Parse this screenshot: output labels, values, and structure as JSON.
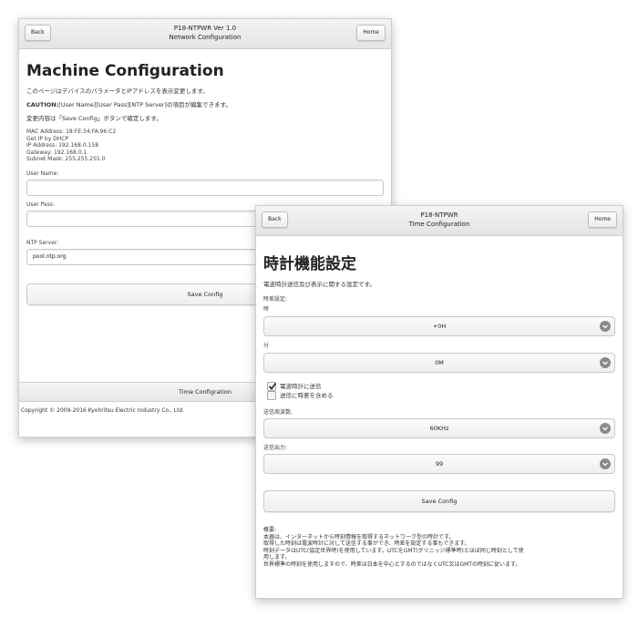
{
  "win1": {
    "back_label": "Back",
    "home_label": "Home",
    "header_title": "P18-NTPWR Ver 1.0",
    "header_subtitle": "Network Configuration",
    "page_title": "Machine Configuration",
    "intro": "このページはデバイスのパラメータとIPアドレスを表示変更します。",
    "caution_prefix": "CAUTION:",
    "caution_text": "[User Name][User Pass][NTP Server]の項目が編集できます。",
    "confirm_text": "変更内容は「Save Config」ボタンで確定します。",
    "mac": "MAC Address: 18:FE:34:FA:96:C2",
    "dhcp": "Get IP by DHCP",
    "ip": "IP Address: 192.168.0.158",
    "gateway": "Gateway: 192.168.0.1",
    "subnet": "Subnet Mask: 255.255.255.0",
    "user_name_label": "User Name:",
    "user_name_value": "",
    "user_pass_label": "User Pass:",
    "user_pass_value": "",
    "ntp_label": "NTP Server:",
    "ntp_value": "pool.ntp.org",
    "save_label": "Save Config",
    "time_nav": "Time Configration",
    "copyright": "Copyright © 2009-2016 Kyohritsu Electric Industry Co., Ltd."
  },
  "win2": {
    "back_label": "Back",
    "home_label": "Home",
    "header_title": "P18-NTPWR",
    "header_subtitle": "Time Configuration",
    "page_title": "時計機能設定",
    "intro": "電波時計送信及び表示に関する設定です。",
    "offset_label": "時差設定:",
    "hour_label": "時",
    "hour_value": "+0H",
    "minute_label": "分",
    "minute_value": "0M",
    "cb_send_label": "電波時計に送信",
    "cb_send_checked": true,
    "cb_offset_label": "送信に時差を含める",
    "cb_offset_checked": false,
    "freq_label": "送信周波数:",
    "freq_value": "60KHz",
    "power_label": "送信出力:",
    "power_value": "99",
    "save_label": "Save Config",
    "summary_title": "概要:",
    "summary_lines": [
      "本器は、インターネットから時刻情報を取得するネットワーク型の時計です。",
      "取得した時刻は電波時計に対して送信する事ができ、時差を設定する事もできます。",
      "時刻データはUTC(協定世界時)を使用しています。UTCをGMT(グリニッジ標準時)とほぼ同じ時刻として使",
      "用します。",
      "世界標準の時刻を使用しますので、時差は日本を中心とするのではなくUTC又はGMTの時刻に従います。"
    ]
  }
}
